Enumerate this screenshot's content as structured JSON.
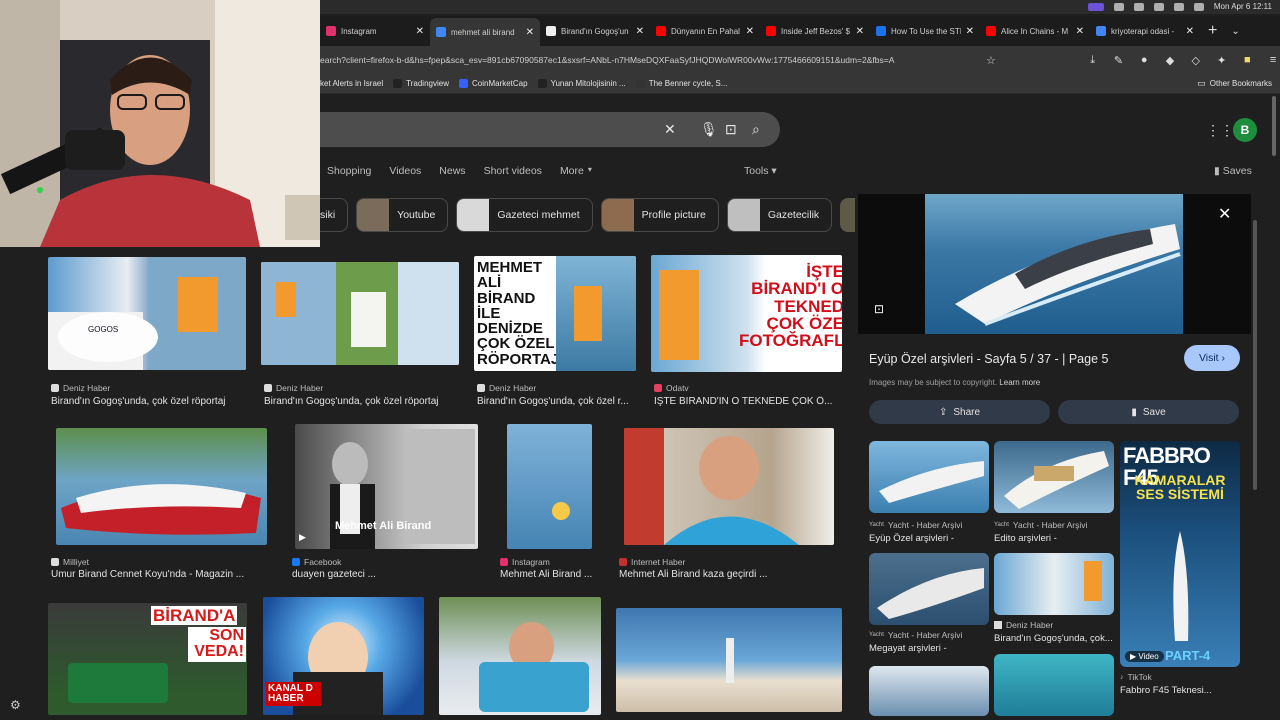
{
  "menubar": {
    "clock": "Mon Apr 6  12:11"
  },
  "tabs": [
    {
      "label": "Instagram",
      "color": "#e1306c",
      "active": false
    },
    {
      "label": "mehmet ali birand",
      "color": "#4285f4",
      "active": true
    },
    {
      "label": "Birand'ın Gogoş'un",
      "color": "#eeeeee",
      "active": false
    },
    {
      "label": "Dünyanın En Pahal",
      "color": "#ff0000",
      "active": false
    },
    {
      "label": "Inside Jeff Bezos' $",
      "color": "#ff0000",
      "active": false
    },
    {
      "label": "How To Use the STI",
      "color": "#1a73e8",
      "active": false
    },
    {
      "label": "Alice In Chains - M",
      "color": "#ff0000",
      "active": false
    },
    {
      "label": "kriyoterapi odasi -",
      "color": "#4285f4",
      "active": false
    }
  ],
  "url": "earch?client=firefox-b-d&hs=fpep&sca_esv=891cb67090587ec1&sxsrf=ANbL-n7HMseDQXFaaSyfJHQDWolWR00vWw:1775466609151&udm=2&fbs=A",
  "bookmarks": [
    {
      "label": "ket Alerts in Israel",
      "color": "#666666"
    },
    {
      "label": "Tradingview",
      "color": "#222222"
    },
    {
      "label": "CoinMarketCap",
      "color": "#3861fb"
    },
    {
      "label": "Yunan Mitolojisinin ...",
      "color": "#222222"
    },
    {
      "label": "The Benner cycle, S...",
      "color": "#333333"
    }
  ],
  "other_bookmarks": "Other Bookmarks",
  "avatar_letter": "B",
  "filters": [
    "Shopping",
    "Videos",
    "News",
    "Short videos",
    "More"
  ],
  "tools": "Tools",
  "saves": "Saves",
  "chips": [
    "siki",
    "Youtube",
    "Gazeteci mehmet",
    "Profile picture",
    "Gazetecilik"
  ],
  "results": [
    {
      "source": "Deniz Haber",
      "caption": "Birand'ın Gogoş'unda, çok özel röportaj"
    },
    {
      "source": "Deniz Haber",
      "caption": "Birand'ın Gogoş'unda, çok özel röportaj"
    },
    {
      "source": "Deniz Haber",
      "caption": "Birand'ın Gogoş'unda, çok özel r..."
    },
    {
      "source": "Odatv",
      "caption": "İŞTE BİRAND'IN O TEKNEDE ÇOK Ö..."
    },
    {
      "source": "Milliyet",
      "caption": "Umur Birand Cennet Koyu'nda - Magazin ..."
    },
    {
      "source": "Facebook",
      "caption": "duayen gazeteci ..."
    },
    {
      "source": "Instagram",
      "caption": "Mehmet Ali Birand ..."
    },
    {
      "source": "Internet Haber",
      "caption": "Mehmet Ali Birand kaza geçirdi ..."
    }
  ],
  "image_texts": {
    "r3": "MEHMET ALİ BİRAND İLE DENİZDE ÇOK ÖZEL RÖPORTAJ",
    "r4": "İŞTE BİRAND'I O TEKNED ÇOK ÖZE FOTOĞRAFLA",
    "r6": "Mehmet Ali Birand",
    "r9_a": "BİRAND'A",
    "r9_b": "SON VEDA!",
    "r10": "KANAL D HABER"
  },
  "panel": {
    "title": "Eyüp Özel arşivleri - Sayfa 5 / 37 - | Page 5",
    "visit": "Visit",
    "copyright": "Images may be subject to copyright.",
    "learn_more": "Learn more",
    "share": "Share",
    "save": "Save",
    "related": [
      {
        "source": "Yacht - Haber Arşivi",
        "caption": "Eyüp Özel arşivleri -"
      },
      {
        "source": "Yacht - Haber Arşivi",
        "caption": "Edito arşivleri -"
      },
      {
        "source": "TikTok",
        "caption": "Fabbro F45 Teknesi..."
      },
      {
        "source": "Yacht - Haber Arşivi",
        "caption": "Megayat arşivleri -"
      },
      {
        "source": "Deniz Haber",
        "caption": "Birand'ın Gogoş'unda, çok..."
      }
    ],
    "fabbro_title": "FABBRO F45",
    "fabbro_sub": "KAMARALAR SES SİSTEMİ",
    "fabbro_part": "PART-4",
    "video_badge": "Video"
  }
}
